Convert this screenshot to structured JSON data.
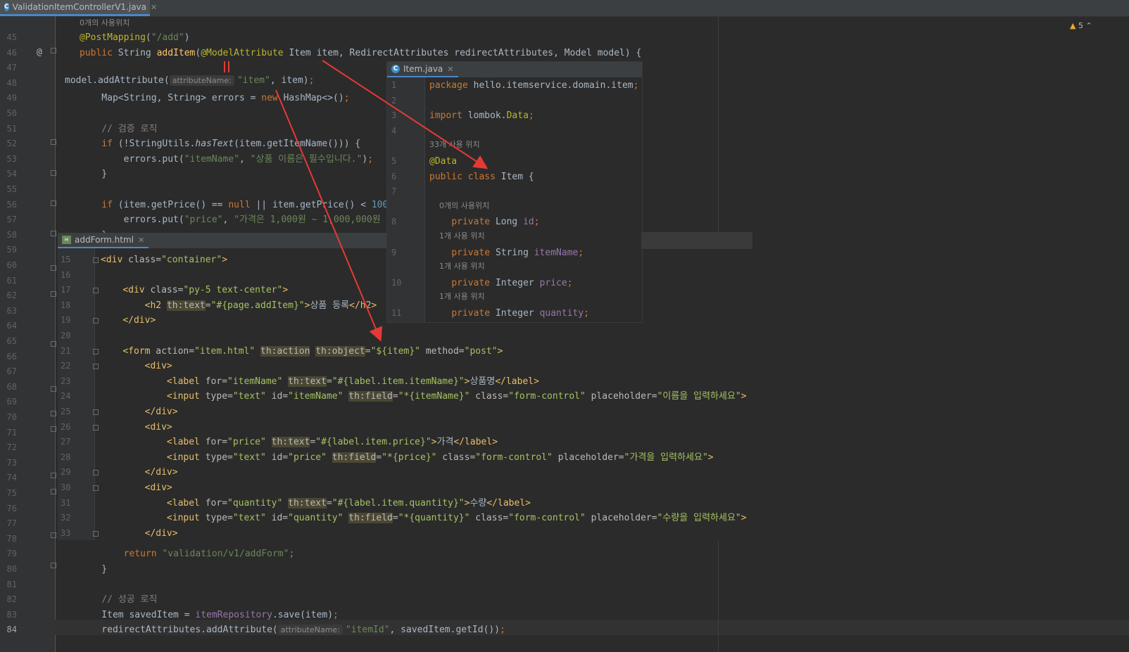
{
  "main_tab": {
    "label": "ValidationItemControllerV1.java"
  },
  "warnings": {
    "count": "5"
  },
  "main_lines": [
    {
      "n": "45",
      "html": "<span class=\"ann\">@PostMapping</span>(<span class=\"str\">\"/add\"</span>)"
    },
    {
      "n": "46",
      "html": "<span class=\"kw\">public </span>String <span class=\"fn\">addItem</span>(<span class=\"ann\">@ModelAttribute</span> Item item, RedirectAttributes redirectAttributes, Model model) {"
    },
    {
      "n": "47",
      "html": ""
    },
    {
      "n": "48",
      "html": ""
    },
    {
      "n": "49",
      "html": "    Map&lt;String, String&gt; errors = <span class=\"kw\">new </span>HashMap&lt;&gt;()<span class=\"kw\">;</span>"
    },
    {
      "n": "50",
      "html": ""
    },
    {
      "n": "51",
      "html": "    <span class=\"cmt\">// 검증 로직</span>"
    },
    {
      "n": "52",
      "html": "    <span class=\"kw\">if </span>(!StringUtils.<span class=\"it\">hasText</span>(item.getItemName())) {"
    },
    {
      "n": "53",
      "html": "        errors.put(<span class=\"str\">\"itemName\"</span>, <span class=\"str\">\"상품 이름은 필수입니다.\"</span>)<span class=\"kw\">;</span>"
    },
    {
      "n": "54",
      "html": "    }"
    },
    {
      "n": "55",
      "html": ""
    },
    {
      "n": "56",
      "html": "    <span class=\"kw\">if </span>(item.getPrice() == <span class=\"kw\">null </span>|| item.getPrice() &lt; <span class=\"num\">100</span>"
    },
    {
      "n": "57",
      "html": "        errors.put(<span class=\"str\">\"price\"</span>, <span class=\"str\">\"가격은 1,000원 ~ 1,000,000원</span>"
    },
    {
      "n": "58",
      "html": "    }"
    },
    {
      "n": "59",
      "html": ""
    },
    {
      "n": "60",
      "html": ""
    },
    {
      "n": "61",
      "html": ""
    },
    {
      "n": "62",
      "html": ""
    },
    {
      "n": "63",
      "html": ""
    },
    {
      "n": "64",
      "html": ""
    },
    {
      "n": "65",
      "html": ""
    },
    {
      "n": "66",
      "html": ""
    },
    {
      "n": "67",
      "html": ""
    },
    {
      "n": "68",
      "html": ""
    },
    {
      "n": "69",
      "html": ""
    },
    {
      "n": "70",
      "html": ""
    },
    {
      "n": "71",
      "html": ""
    },
    {
      "n": "72",
      "html": ""
    },
    {
      "n": "73",
      "html": ""
    },
    {
      "n": "74",
      "html": ""
    },
    {
      "n": "75",
      "html": ""
    },
    {
      "n": "76",
      "html": ""
    },
    {
      "n": "77",
      "html": ""
    },
    {
      "n": "78",
      "html": ""
    },
    {
      "n": "79",
      "html": "        <span class=\"kw\">return </span><span class=\"str\">\"validation/v1/addForm\"</span><span class=\"kw\">;</span>"
    },
    {
      "n": "80",
      "html": "    }"
    },
    {
      "n": "81",
      "html": ""
    },
    {
      "n": "82",
      "html": "    <span class=\"cmt\">// 성공 로직</span>"
    },
    {
      "n": "83",
      "html": "    Item savedItem = <span class=\"fld\">itemRepository</span>.save(item)<span class=\"kw\">;</span>"
    },
    {
      "n": "84",
      "html": "    redirectAttributes.addAttribute(<span class=\"inlay\">attributeName:</span><span class=\"str\">\"itemId\"</span>, savedItem.getId())<span class=\"kw\">;</span>"
    }
  ],
  "usage_hint_top": "0개의 사용위치",
  "line48_html": "model.addAttribute(<span class=\"inlay\">attributeName:</span><span class=\"str\">\"item\"</span>, item)<span class=\"kw\">;</span>",
  "item_popup": {
    "tab": "Item.java",
    "lines": [
      {
        "n": "1",
        "html": "<span class=\"kw\">package </span>hello.itemservice.domain.item<span class=\"kw\">;</span>"
      },
      {
        "n": "2",
        "html": ""
      },
      {
        "n": "3",
        "html": "<span class=\"kw\">import </span>lombok.<span class=\"ann\">Data</span><span class=\"kw\">;</span>"
      },
      {
        "n": "4",
        "html": ""
      },
      {
        "hint": "33개 사용 위치"
      },
      {
        "n": "5",
        "html": "<span class=\"ann\">@Data</span>"
      },
      {
        "n": "6",
        "html": "<span class=\"kw\">public class </span>Item {"
      },
      {
        "n": "7",
        "html": ""
      },
      {
        "hint": "    0개의 사용위치"
      },
      {
        "n": "8",
        "html": "    <span class=\"kw\">private </span>Long <span class=\"fld\">id</span><span class=\"kw\">;</span>"
      },
      {
        "hint": "    1개 사용 위치"
      },
      {
        "n": "9",
        "html": "    <span class=\"kw\">private </span>String <span class=\"fld\">itemName</span><span class=\"kw\">;</span>"
      },
      {
        "hint": "    1개 사용 위치"
      },
      {
        "n": "10",
        "html": "    <span class=\"kw\">private </span>Integer <span class=\"fld\">price</span><span class=\"kw\">;</span>"
      },
      {
        "hint": "    1개 사용 위치"
      },
      {
        "n": "11",
        "html": "    <span class=\"kw\">private </span>Integer <span class=\"fld\">quantity</span><span class=\"kw\">;</span>"
      }
    ]
  },
  "form_popup": {
    "tab": "addForm.html",
    "lines": [
      {
        "n": "15",
        "html": "<span class=\"tag\">&lt;div </span><span class=\"attr\">class=</span><span class=\"hstr\">\"container\"</span><span class=\"tag\">&gt;</span>"
      },
      {
        "n": "16",
        "html": ""
      },
      {
        "n": "17",
        "html": "    <span class=\"tag\">&lt;div </span><span class=\"attr\">class=</span><span class=\"hstr\">\"py-5 text-center\"</span><span class=\"tag\">&gt;</span>"
      },
      {
        "n": "18",
        "html": "        <span class=\"tag\">&lt;h2 </span><span class=\"thattr\">th:text</span><span class=\"attr\">=</span><span class=\"hstr\">\"#{page.addItem}\"</span><span class=\"tag\">&gt;</span>상품 등록<span class=\"tag\">&lt;/h2&gt;</span>"
      },
      {
        "n": "19",
        "html": "    <span class=\"tag\">&lt;/div&gt;</span>"
      },
      {
        "n": "20",
        "html": ""
      },
      {
        "n": "21",
        "html": "    <span class=\"tag\">&lt;form </span><span class=\"attr\">action=</span><span class=\"hstr\">\"item.html\"</span> <span class=\"thattr\">th:action</span> <span class=\"thattr\">th:object</span><span class=\"attr\">=</span><span class=\"hstr\">\"${item}\"</span> <span class=\"attr\">method=</span><span class=\"hstr\">\"post\"</span><span class=\"tag\">&gt;</span>"
      },
      {
        "n": "22",
        "html": "        <span class=\"tag\">&lt;div&gt;</span>"
      },
      {
        "n": "23",
        "html": "            <span class=\"tag\">&lt;label </span><span class=\"attr\">for=</span><span class=\"hstr\">\"itemName\"</span> <span class=\"thattr\">th:text</span><span class=\"attr\">=</span><span class=\"hstr\">\"#{label.item.itemName}\"</span><span class=\"tag\">&gt;</span>상품명<span class=\"tag\">&lt;/label&gt;</span>"
      },
      {
        "n": "24",
        "html": "            <span class=\"tag\">&lt;input </span><span class=\"attr\">type=</span><span class=\"hstr\">\"text\"</span> <span class=\"attr\">id=</span><span class=\"hstr\">\"itemName\"</span> <span class=\"thattr\">th:field</span><span class=\"attr\">=</span><span class=\"hstr\">\"*{itemName}\"</span> <span class=\"attr\">class=</span><span class=\"hstr\">\"form-control\"</span> <span class=\"attr\">placeholder=</span><span class=\"hstr\">\"이름을 입력하세요\"</span><span class=\"tag\">&gt;</span>"
      },
      {
        "n": "25",
        "html": "        <span class=\"tag\">&lt;/div&gt;</span>"
      },
      {
        "n": "26",
        "html": "        <span class=\"tag\">&lt;div&gt;</span>"
      },
      {
        "n": "27",
        "html": "            <span class=\"tag\">&lt;label </span><span class=\"attr\">for=</span><span class=\"hstr\">\"price\"</span> <span class=\"thattr\">th:text</span><span class=\"attr\">=</span><span class=\"hstr\">\"#{label.item.price}\"</span><span class=\"tag\">&gt;</span>가격<span class=\"tag\">&lt;/label&gt;</span>"
      },
      {
        "n": "28",
        "html": "            <span class=\"tag\">&lt;input </span><span class=\"attr\">type=</span><span class=\"hstr\">\"text\"</span> <span class=\"attr\">id=</span><span class=\"hstr\">\"price\"</span> <span class=\"thattr\">th:field</span><span class=\"attr\">=</span><span class=\"hstr\">\"*{price}\"</span> <span class=\"attr\">class=</span><span class=\"hstr\">\"form-control\"</span> <span class=\"attr\">placeholder=</span><span class=\"hstr\">\"가격을 입력하세요\"</span><span class=\"tag\">&gt;</span>"
      },
      {
        "n": "29",
        "html": "        <span class=\"tag\">&lt;/div&gt;</span>"
      },
      {
        "n": "30",
        "html": "        <span class=\"tag\">&lt;div&gt;</span>"
      },
      {
        "n": "31",
        "html": "            <span class=\"tag\">&lt;label </span><span class=\"attr\">for=</span><span class=\"hstr\">\"quantity\"</span> <span class=\"thattr\">th:text</span><span class=\"attr\">=</span><span class=\"hstr\">\"#{label.item.quantity}\"</span><span class=\"tag\">&gt;</span>수량<span class=\"tag\">&lt;/label&gt;</span>"
      },
      {
        "n": "32",
        "html": "            <span class=\"tag\">&lt;input </span><span class=\"attr\">type=</span><span class=\"hstr\">\"text\"</span> <span class=\"attr\">id=</span><span class=\"hstr\">\"quantity\"</span> <span class=\"thattr\">th:field</span><span class=\"attr\">=</span><span class=\"hstr\">\"*{quantity}\"</span> <span class=\"attr\">class=</span><span class=\"hstr\">\"form-control\"</span> <span class=\"attr\">placeholder=</span><span class=\"hstr\">\"수량을 입력하세요\"</span><span class=\"tag\">&gt;</span>"
      },
      {
        "n": "33",
        "html": "        <span class=\"tag\">&lt;/div&gt;</span>"
      }
    ]
  },
  "colors": {
    "background": "#2b2b2b",
    "keyword": "#cc7832",
    "string": "#6a8759",
    "annotation": "#bbb529",
    "arrow": "#e53935"
  }
}
